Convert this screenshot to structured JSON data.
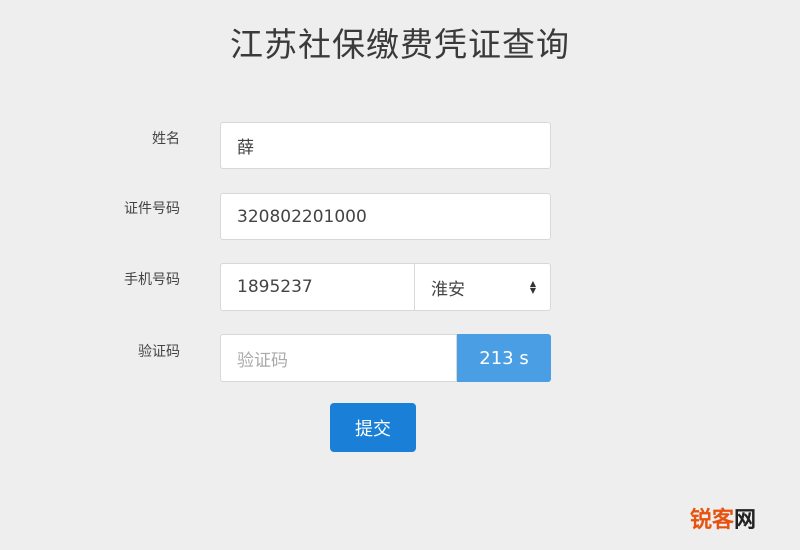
{
  "page": {
    "title": "江苏社保缴费凭证查询"
  },
  "form": {
    "name": {
      "label": "姓名",
      "value": "薛"
    },
    "id_number": {
      "label": "证件号码",
      "value": "320802201000"
    },
    "phone": {
      "label": "手机号码",
      "value": "1895237",
      "region_selected": "淮安"
    },
    "captcha": {
      "label": "验证码",
      "placeholder": "验证码",
      "countdown": "213 s"
    },
    "submit_label": "提交"
  },
  "watermark": {
    "part1": "锐客",
    "part2": "网"
  },
  "colors": {
    "countdown_bg": "#4a9ee3",
    "submit_bg": "#1a7fd6",
    "watermark": "#e8520f"
  }
}
